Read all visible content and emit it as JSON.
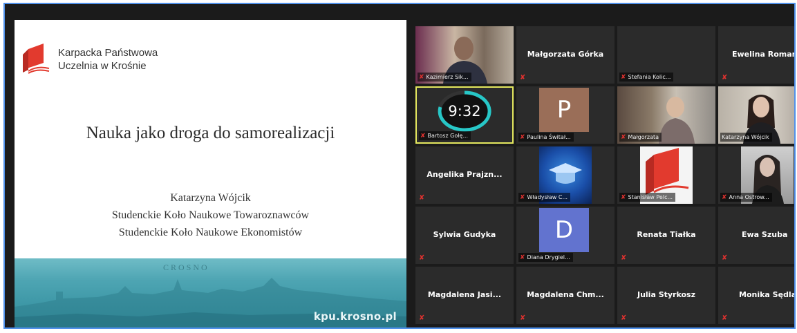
{
  "slide": {
    "logo_text_1": "Karpacka Państwowa",
    "logo_text_2": "Uczelnia w Krośnie",
    "title": "Nauka jako droga do samorealizacji",
    "author": "Katarzyna Wójcik",
    "line_2": "Studenckie Koło Naukowe Towaroznawców",
    "line_3": "Studenckie Koło Naukowe Ekonomistów",
    "banner_city": "CROSNO",
    "banner_site": "kpu.krosno.pl",
    "brand_color": "#e23a2e",
    "banner_color": "#4ea5b3"
  },
  "timer": {
    "value": "9:32",
    "ring_color": "#27c7c7"
  },
  "participants": [
    {
      "label": "Kazimierz Sik...",
      "kind": "video"
    },
    {
      "label": "Małgorzata Górka",
      "kind": "name"
    },
    {
      "label": "Stefania Kolic...",
      "kind": "blank"
    },
    {
      "label": "Ewelina Roman",
      "kind": "name"
    },
    {
      "label": "Bartosz Gołę...",
      "kind": "timer"
    },
    {
      "label": "Paulina Świtał...",
      "kind": "avatar",
      "initial": "P",
      "avatar_color": "#9a6e58"
    },
    {
      "label": "Małgorzata",
      "kind": "video"
    },
    {
      "label": "Katarzyna Wójcik",
      "kind": "video"
    },
    {
      "label": "Angelika Prajzn...",
      "kind": "name"
    },
    {
      "label": "Władysław C...",
      "kind": "image"
    },
    {
      "label": "Stanisław Pelc...",
      "kind": "image"
    },
    {
      "label": "Anna Ostrow...",
      "kind": "video"
    },
    {
      "label": "Sylwia Gudyka",
      "kind": "name"
    },
    {
      "label": "Diana Drygiel...",
      "kind": "avatar",
      "initial": "D",
      "avatar_color": "#6273cf"
    },
    {
      "label": "Renata Tiałka",
      "kind": "name"
    },
    {
      "label": "Ewa Szuba",
      "kind": "name"
    },
    {
      "label": "Magdalena Jasi...",
      "kind": "name"
    },
    {
      "label": "Magdalena Chm...",
      "kind": "name"
    },
    {
      "label": "Julia Styrkosz",
      "kind": "name"
    },
    {
      "label": "Monika Sędla",
      "kind": "name"
    }
  ],
  "icons": {
    "muted": "muted-mic-icon"
  }
}
